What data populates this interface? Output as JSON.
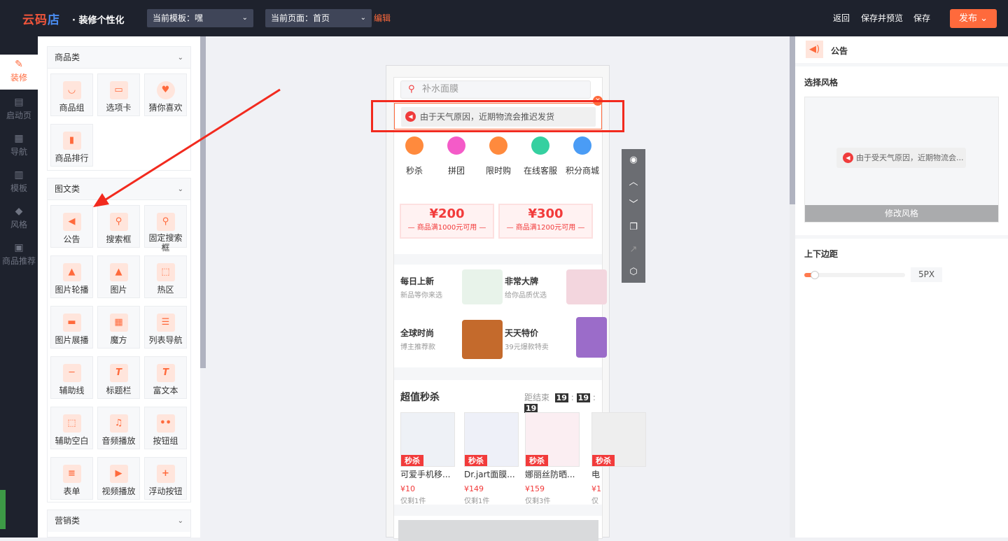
{
  "header": {
    "logo": "云码店",
    "title": "· 装修个性化",
    "template_select": "当前模板：嘿",
    "page_select": "当前页面：首页",
    "edit_link": "编辑",
    "back": "返回",
    "save_preview": "保存并预览",
    "save": "保存",
    "publish": "发布"
  },
  "sidenav": [
    {
      "label": "装修",
      "icon": "brush-icon"
    },
    {
      "label": "启动页",
      "icon": "page-icon"
    },
    {
      "label": "导航",
      "icon": "grid-icon"
    },
    {
      "label": "模板",
      "icon": "template-icon"
    },
    {
      "label": "风格",
      "icon": "paint-bucket-icon"
    },
    {
      "label": "商品推荐",
      "icon": "recommend-icon"
    }
  ],
  "components": {
    "goods": {
      "title": "商品类",
      "items": [
        "商品组",
        "选项卡",
        "猜你喜欢",
        "商品排行"
      ]
    },
    "media": {
      "title": "图文类",
      "items": [
        "公告",
        "搜索框",
        "固定搜索框",
        "图片轮播",
        "图片",
        "热区",
        "图片展播",
        "魔方",
        "列表导航",
        "辅助线",
        "标题栏",
        "富文本",
        "辅助空白",
        "音频播放",
        "按钮组",
        "表单",
        "视频播放",
        "浮动按钮"
      ]
    },
    "marketing": {
      "title": "营销类"
    }
  },
  "phone": {
    "search_placeholder": "补水面膜",
    "notice": "由于天气原因，近期物流会推迟发货",
    "nav": [
      "秒杀",
      "拼团",
      "限时购",
      "在线客服",
      "积分商城"
    ],
    "nav_colors": [
      "#ff8a3d",
      "#f45bc8",
      "#ff8a3d",
      "#35d0a0",
      "#4a9cf5"
    ],
    "coupons": [
      {
        "amount": "¥200",
        "cond": "— 商品满1000元可用 —"
      },
      {
        "amount": "¥300",
        "cond": "— 商品满1200元可用 —"
      }
    ],
    "features": [
      {
        "title": "每日上新",
        "sub": "新品等你来选"
      },
      {
        "title": "非常大牌",
        "sub": "给你品质优选"
      },
      {
        "title": "全球时尚",
        "sub": "博主推荐款"
      },
      {
        "title": "天天特价",
        "sub": "39元爆款特卖"
      }
    ],
    "flash": {
      "title": "超值秒杀",
      "ends": "距结束",
      "h": "19",
      "m": "19",
      "s": "19",
      "sep": ":",
      "tag": "秒杀",
      "products": [
        {
          "name": "可爱手机移...",
          "price": "¥10",
          "left": "仅剩1件"
        },
        {
          "name": "Dr.jart面膜...",
          "price": "¥149",
          "left": "仅剩1件"
        },
        {
          "name": "娜丽丝防晒...",
          "price": "¥159",
          "left": "仅剩3件"
        },
        {
          "name": "电",
          "price": "¥1",
          "left": "仅"
        }
      ]
    }
  },
  "right": {
    "title": "公告",
    "style_label": "选择风格",
    "preview_notice": "由于受天气原因，近期物流会...",
    "change_style": "修改风格",
    "margin_label": "上下边距",
    "margin_value": "5PX",
    "margin_fraction": 0.05
  }
}
